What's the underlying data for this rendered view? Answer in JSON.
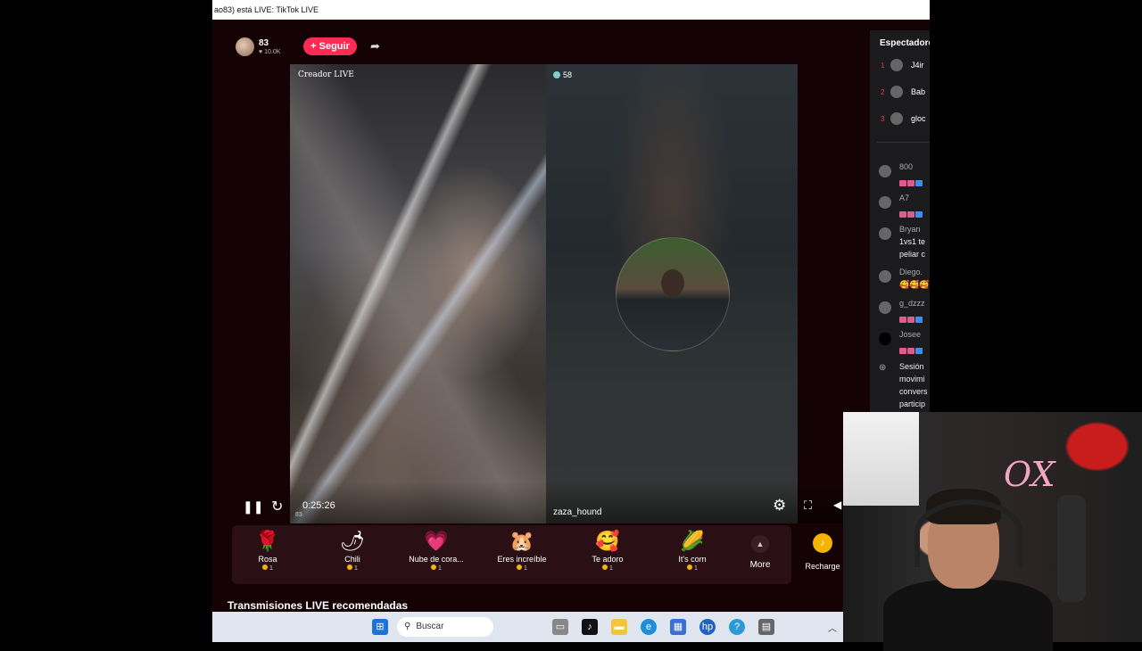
{
  "browser": {
    "title": "ao83) está LIVE: TikTok LIVE"
  },
  "live_header": {
    "host_count": "83",
    "host_likes": "♥ 10.0K",
    "follow_label": "+ Seguir"
  },
  "video": {
    "left_tag": "Creador LIVE",
    "viewer_count": "58",
    "guest_name": "zaza_hound",
    "elapsed_time": "0:25:26",
    "elapsed_sub": "83"
  },
  "gifts": [
    {
      "name": "Rosa",
      "price": "1",
      "icon": "🌹"
    },
    {
      "name": "Chili",
      "price": "1",
      "icon": "🌶"
    },
    {
      "name": "Nube de cora...",
      "price": "1",
      "icon": "💗"
    },
    {
      "name": "Eres increíble",
      "price": "1",
      "icon": "🐹"
    },
    {
      "name": "Te adoro",
      "price": "1",
      "icon": "🥰"
    },
    {
      "name": "It's corn",
      "price": "1",
      "icon": "🌽"
    }
  ],
  "gift_more_label": "More",
  "recharge_label": "Recharge",
  "recommended_heading": "Transmisiones LIVE recomendadas",
  "panel": {
    "title": "Espectadores",
    "ranked": [
      {
        "rank": "1",
        "name": "J4ir"
      },
      {
        "rank": "2",
        "name": "Bab"
      },
      {
        "rank": "3",
        "name": "gloc"
      }
    ],
    "comments": [
      {
        "name": "800",
        "text": ""
      },
      {
        "name": "A7",
        "text": ""
      },
      {
        "name": "Bryan",
        "text": "1vs1 te"
      },
      {
        "name": "",
        "text": "peliar c"
      },
      {
        "name": "Diego.",
        "text": ""
      },
      {
        "name": "g_dzzz",
        "text": ""
      },
      {
        "name": "Josee",
        "text": ""
      }
    ],
    "session_lines": [
      "Sesión",
      "movimi",
      "convers",
      "particip"
    ]
  },
  "taskbar": {
    "search_placeholder": "Buscar"
  },
  "colors": {
    "accent": "#fe2c55",
    "gift_bar_bg": "#2a1014",
    "coin": "#f2b705"
  }
}
